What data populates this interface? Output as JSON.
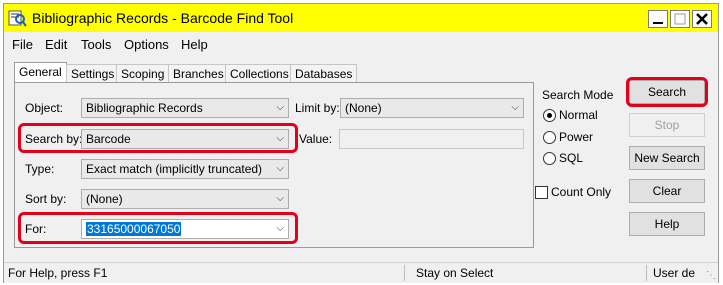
{
  "window": {
    "title": "Bibliographic Records - Barcode Find Tool"
  },
  "menu": [
    "File",
    "Edit",
    "Tools",
    "Options",
    "Help"
  ],
  "tabs": [
    "General",
    "Settings",
    "Scoping",
    "Branches",
    "Collections",
    "Databases"
  ],
  "form": {
    "object_label": "Object:",
    "object_value": "Bibliographic Records",
    "limit_label": "Limit by:",
    "limit_value": "(None)",
    "search_by_label": "Search by:",
    "search_by_value": "Barcode",
    "value_label": "Value:",
    "type_label": "Type:",
    "type_value": "Exact match (implicitly truncated)",
    "sort_label": "Sort by:",
    "sort_value": "(None)",
    "for_label": "For:",
    "for_value": "33165000067050"
  },
  "search_mode": {
    "label": "Search Mode",
    "options": [
      "Normal",
      "Power",
      "SQL"
    ],
    "selected": "Normal",
    "count_only": "Count Only"
  },
  "buttons": {
    "search": "Search",
    "stop": "Stop",
    "new_search": "New Search",
    "clear": "Clear",
    "help": "Help"
  },
  "status": {
    "help_text": "For Help, press F1",
    "mode_text": "Stay on Select",
    "user_text": "User de"
  },
  "colors": {
    "title_bar": "#ffff00",
    "highlight": "#e3001b",
    "selection": "#0078d7"
  }
}
